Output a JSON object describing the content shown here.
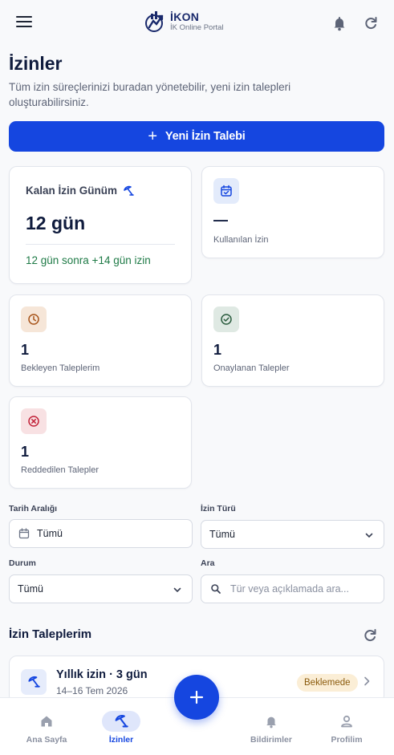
{
  "header": {
    "logo_title": "İKON",
    "logo_subtitle": "İK Online Portal",
    "icons": [
      "menu-icon",
      "bell-icon",
      "refresh-icon"
    ]
  },
  "page": {
    "title": "İzinler",
    "description": "Tüm izin süreçlerinizi buradan yönetebilir, yeni izin talepleri oluşturabilirsiniz."
  },
  "new_request_button": "Yeni İzin Talebi",
  "stats": {
    "remaining": {
      "label": "Kalan İzin Günüm",
      "value": "12 gün",
      "next": "12 gün sonra +14 gün izin"
    },
    "used": {
      "value": "—",
      "label": "Kullanılan İzin"
    },
    "pending": {
      "value": "1",
      "label": "Bekleyen Taleplerim"
    },
    "approved": {
      "value": "1",
      "label": "Onaylanan Talepler"
    },
    "rejected": {
      "value": "1",
      "label": "Reddedilen Talepler"
    }
  },
  "filters": {
    "date_range": {
      "label": "Tarih Aralığı",
      "value": "Tümü"
    },
    "leave_type": {
      "label": "İzin Türü",
      "value": "Tümü"
    },
    "status": {
      "label": "Durum",
      "value": "Tümü"
    },
    "search": {
      "label": "Ara",
      "placeholder": "Tür veya açıklamada ara..."
    }
  },
  "requests": {
    "title": "İzin Taleplerim",
    "items": [
      {
        "title": "Yıllık izin · 3 gün",
        "dates": "14–16 Tem 2026",
        "status": "Beklemede"
      }
    ]
  },
  "bottom_nav": {
    "items": [
      {
        "label": "Ana Sayfa",
        "icon": "home-icon"
      },
      {
        "label": "İzinler",
        "icon": "beach-umbrella-icon",
        "active": true
      },
      {
        "label": "Bildirimler",
        "icon": "bell-icon"
      },
      {
        "label": "Profilim",
        "icon": "user-icon"
      }
    ]
  },
  "colors": {
    "primary": "#1546e0",
    "success_text": "#1e7a46",
    "pending_bg": "#fbeed6",
    "pending_text": "#8a5a0c"
  }
}
